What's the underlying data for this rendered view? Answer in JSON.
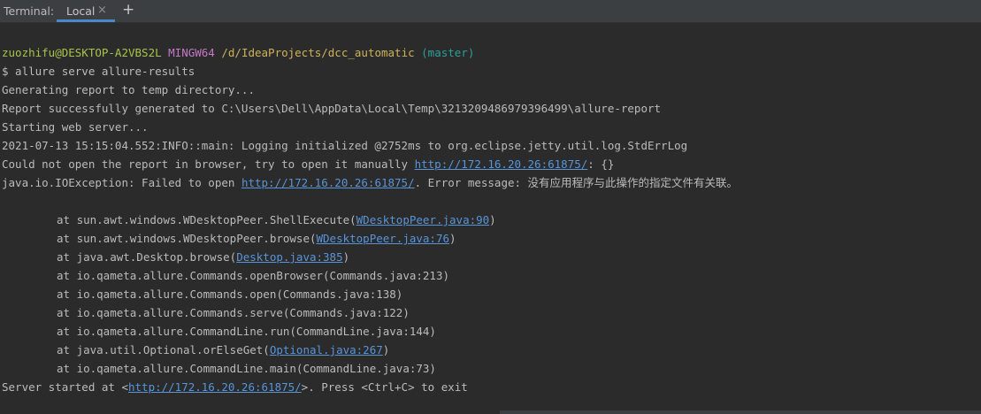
{
  "tabbar": {
    "caption": "Terminal:",
    "tab_label": "Local",
    "close_glyph": "×",
    "add_glyph": "+"
  },
  "prompt": {
    "user_host": "zuozhifu@DESKTOP-A2VBS2L",
    "shell": "MINGW64",
    "path": "/d/IdeaProjects/dcc_automatic",
    "branch": "(master)"
  },
  "command": "$ allure serve allure-results",
  "output": {
    "generating": "Generating report to temp directory...",
    "generated": "Report successfully generated to C:\\Users\\Dell\\AppData\\Local\\Temp\\3213209486979396499\\allure-report",
    "starting": "Starting web server...",
    "logging": "2021-07-13 15:15:04.552:INFO::main: Logging initialized @2752ms to org.eclipse.jetty.util.log.StdErrLog",
    "could_not_open_prefix": "Could not open the report in browser, try to open it manually ",
    "could_not_open_url": "http://172.16.20.26:61875/",
    "could_not_open_suffix": ": {}",
    "exception_prefix": "java.io.IOException: Failed to open ",
    "exception_url": "http://172.16.20.26:61875/",
    "exception_suffix": ". Error message: 没有应用程序与此操作的指定文件有关联。",
    "stack": [
      {
        "prefix": "at sun.awt.windows.WDesktopPeer.ShellExecute(",
        "link": "WDesktopPeer.java:90",
        "suffix": ")"
      },
      {
        "prefix": "at sun.awt.windows.WDesktopPeer.browse(",
        "link": "WDesktopPeer.java:76",
        "suffix": ")"
      },
      {
        "prefix": "at java.awt.Desktop.browse(",
        "link": "Desktop.java:385",
        "suffix": ")"
      },
      {
        "text": "at io.qameta.allure.Commands.openBrowser(Commands.java:213)"
      },
      {
        "text": "at io.qameta.allure.Commands.open(Commands.java:138)"
      },
      {
        "text": "at io.qameta.allure.Commands.serve(Commands.java:122)"
      },
      {
        "text": "at io.qameta.allure.CommandLine.run(CommandLine.java:144)"
      },
      {
        "prefix": "at java.util.Optional.orElseGet(",
        "link": "Optional.java:267",
        "suffix": ")"
      },
      {
        "text": "at io.qameta.allure.CommandLine.main(CommandLine.java:73)"
      }
    ],
    "server_prefix": "Server started at <",
    "server_url": "http://172.16.20.26:61875/",
    "server_suffix": ">. Press <Ctrl+C> to exit"
  },
  "colors": {
    "background": "#2b2b2b",
    "text": "#bbbbbb",
    "user_host": "#a7c44b",
    "shell": "#c378c8",
    "path": "#cdb35a",
    "branch": "#2aa198",
    "link": "#5894d8",
    "tab_underline": "#4a88c7"
  }
}
